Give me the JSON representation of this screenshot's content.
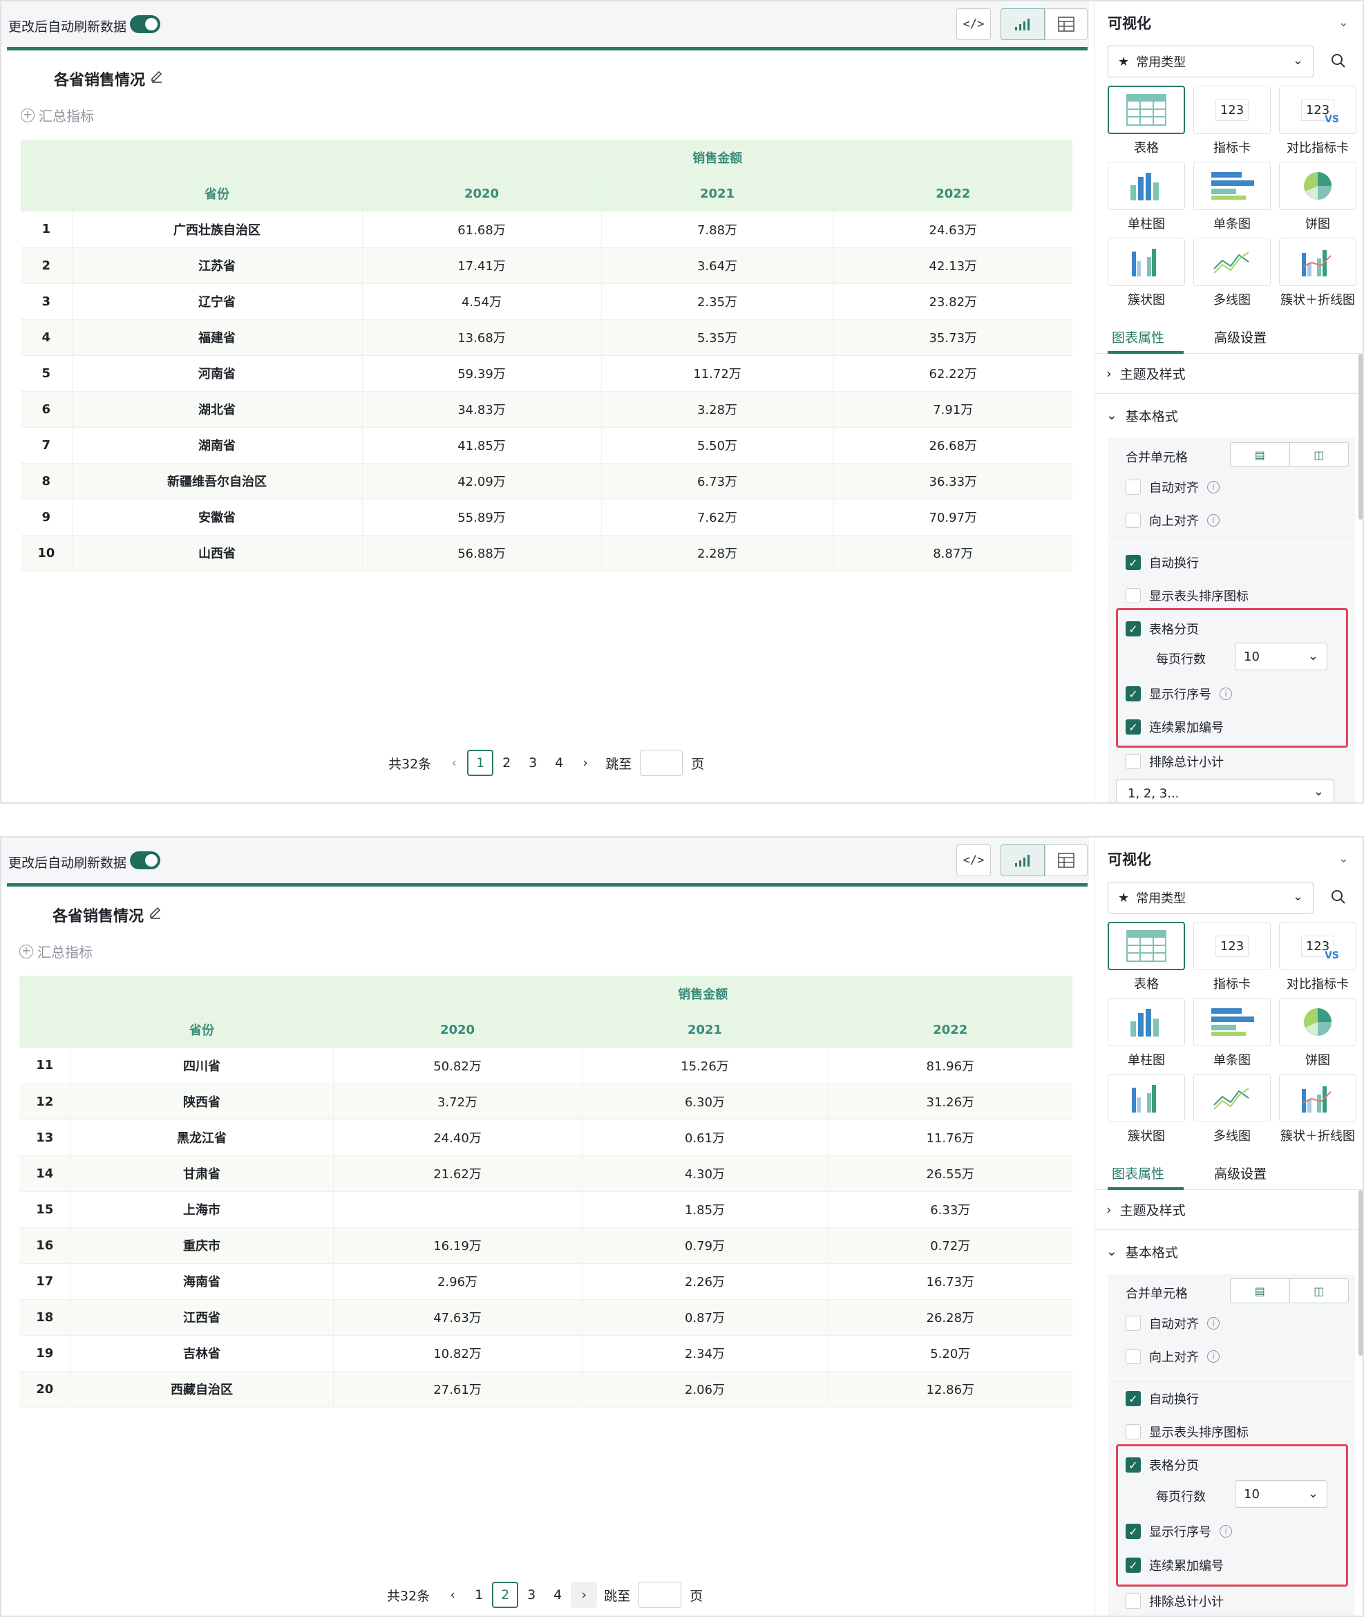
{
  "common": {
    "refresh_label": "更改后自动刷新数据",
    "code_icon": "</>",
    "chart_title": "各省销售情况",
    "summary_label": "汇总指标",
    "header_group": "销售金额",
    "header_province": "省份",
    "years": [
      "2020",
      "2021",
      "2022"
    ],
    "pager_total": "共32条",
    "pager_pages": [
      "1",
      "2",
      "3",
      "4"
    ],
    "pager_jump": "跳至",
    "pager_page_unit": "页",
    "side_title": "可视化",
    "type_select": "常用类型",
    "chart_types": [
      {
        "label": "表格",
        "icon": "table-icon"
      },
      {
        "label": "指标卡",
        "icon": "kpi-card-icon",
        "text": "123"
      },
      {
        "label": "对比指标卡",
        "icon": "compare-kpi-icon",
        "text": "123",
        "vs": "VS"
      },
      {
        "label": "单柱图",
        "icon": "bar-chart-icon"
      },
      {
        "label": "单条图",
        "icon": "horizontal-bar-icon"
      },
      {
        "label": "饼图",
        "icon": "pie-chart-icon"
      },
      {
        "label": "簇状图",
        "icon": "clustered-bar-icon"
      },
      {
        "label": "多线图",
        "icon": "multi-line-icon"
      },
      {
        "label": "簇状＋折线图",
        "icon": "combo-chart-icon"
      }
    ],
    "tab_chart_props": "图表属性",
    "tab_advanced": "高级设置",
    "sec_theme": "主题及样式",
    "sec_basic": "基本格式",
    "opt_merge": "合并单元格",
    "opt_auto_align": "自动对齐",
    "opt_up_align": "向上对齐",
    "opt_wrap": "自动换行",
    "opt_sort_icon": "显示表头排序图标",
    "opt_paging": "表格分页",
    "opt_rows_per_page": "每页行数",
    "rows_per_page_value": "10",
    "opt_row_number": "显示行序号",
    "opt_continuous": "连续累加编号",
    "opt_exclude_subtotal": "排除总计小计",
    "seq_select": "1, 2, 3..."
  },
  "panel1": {
    "current_page": "1",
    "rows": [
      {
        "idx": "1",
        "province": "广西壮族自治区",
        "v2020": "61.68万",
        "v2021": "7.88万",
        "v2022": "24.63万"
      },
      {
        "idx": "2",
        "province": "江苏省",
        "v2020": "17.41万",
        "v2021": "3.64万",
        "v2022": "42.13万"
      },
      {
        "idx": "3",
        "province": "辽宁省",
        "v2020": "4.54万",
        "v2021": "2.35万",
        "v2022": "23.82万"
      },
      {
        "idx": "4",
        "province": "福建省",
        "v2020": "13.68万",
        "v2021": "5.35万",
        "v2022": "35.73万"
      },
      {
        "idx": "5",
        "province": "河南省",
        "v2020": "59.39万",
        "v2021": "11.72万",
        "v2022": "62.22万"
      },
      {
        "idx": "6",
        "province": "湖北省",
        "v2020": "34.83万",
        "v2021": "3.28万",
        "v2022": "7.91万"
      },
      {
        "idx": "7",
        "province": "湖南省",
        "v2020": "41.85万",
        "v2021": "5.50万",
        "v2022": "26.68万"
      },
      {
        "idx": "8",
        "province": "新疆维吾尔自治区",
        "v2020": "42.09万",
        "v2021": "6.73万",
        "v2022": "36.33万"
      },
      {
        "idx": "9",
        "province": "安徽省",
        "v2020": "55.89万",
        "v2021": "7.62万",
        "v2022": "70.97万"
      },
      {
        "idx": "10",
        "province": "山西省",
        "v2020": "56.88万",
        "v2021": "2.28万",
        "v2022": "8.87万"
      }
    ]
  },
  "panel2": {
    "current_page": "2",
    "rows": [
      {
        "idx": "11",
        "province": "四川省",
        "v2020": "50.82万",
        "v2021": "15.26万",
        "v2022": "81.96万"
      },
      {
        "idx": "12",
        "province": "陕西省",
        "v2020": "3.72万",
        "v2021": "6.30万",
        "v2022": "31.26万"
      },
      {
        "idx": "13",
        "province": "黑龙江省",
        "v2020": "24.40万",
        "v2021": "0.61万",
        "v2022": "11.76万"
      },
      {
        "idx": "14",
        "province": "甘肃省",
        "v2020": "21.62万",
        "v2021": "4.30万",
        "v2022": "26.55万"
      },
      {
        "idx": "15",
        "province": "上海市",
        "v2020": "",
        "v2021": "1.85万",
        "v2022": "6.33万"
      },
      {
        "idx": "16",
        "province": "重庆市",
        "v2020": "16.19万",
        "v2021": "0.79万",
        "v2022": "0.72万"
      },
      {
        "idx": "17",
        "province": "海南省",
        "v2020": "2.96万",
        "v2021": "2.26万",
        "v2022": "16.73万"
      },
      {
        "idx": "18",
        "province": "江西省",
        "v2020": "47.63万",
        "v2021": "0.87万",
        "v2022": "26.28万"
      },
      {
        "idx": "19",
        "province": "吉林省",
        "v2020": "10.82万",
        "v2021": "2.34万",
        "v2022": "5.20万"
      },
      {
        "idx": "20",
        "province": "西藏自治区",
        "v2020": "27.61万",
        "v2021": "2.06万",
        "v2022": "12.86万"
      }
    ]
  },
  "colors": {
    "accent": "#2a7a6a",
    "header_bg": "#e6f5e4",
    "highlight": "#e0435a"
  }
}
